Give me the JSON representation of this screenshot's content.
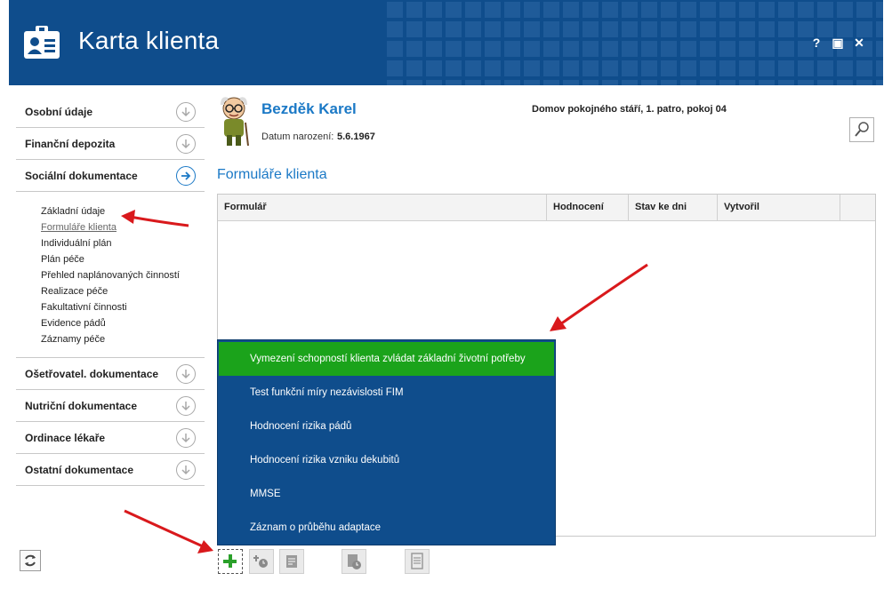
{
  "app": {
    "title": "Karta klienta",
    "help_label": "?",
    "maximize_label": "▣",
    "close_label": "✕"
  },
  "sidebar": {
    "sections": [
      {
        "label": "Osobní údaje"
      },
      {
        "label": "Finanční depozita"
      },
      {
        "label": "Sociální dokumentace",
        "active": true
      },
      {
        "label": "Ošetřovatel. dokumentace"
      },
      {
        "label": "Nutriční dokumentace"
      },
      {
        "label": "Ordinace lékaře"
      },
      {
        "label": "Ostatní dokumentace"
      }
    ],
    "subitems": [
      {
        "label": "Základní údaje"
      },
      {
        "label": "Formuláře klienta",
        "current": true
      },
      {
        "label": "Individuální plán"
      },
      {
        "label": "Plán péče"
      },
      {
        "label": "Přehled naplánovaných činností"
      },
      {
        "label": "Realizace péče"
      },
      {
        "label": "Fakultativní činnosti"
      },
      {
        "label": "Evidence pádů"
      },
      {
        "label": "Záznamy péče"
      }
    ]
  },
  "client": {
    "name": "Bezděk Karel",
    "dob_label": "Datum narození:",
    "dob_value": "5.6.1967",
    "location": "Domov pokojného stáří, 1. patro, pokoj 04"
  },
  "main": {
    "section_title": "Formuláře klienta",
    "table": {
      "columns": [
        "Formulář",
        "Hodnocení",
        "Stav ke dni",
        "Vytvořil"
      ],
      "rows": []
    }
  },
  "menu": {
    "items": [
      {
        "label": "Vymezení schopností klienta zvládat základní životní potřeby",
        "highlighted": true
      },
      {
        "label": "Test funkční míry nezávislosti FIM"
      },
      {
        "label": "Hodnocení rizika pádů"
      },
      {
        "label": "Hodnocení rizika vzniku dekubitů"
      },
      {
        "label": "MMSE"
      },
      {
        "label": "Záznam o průběhu adaptace"
      }
    ]
  },
  "toolbar": {
    "buttons": [
      {
        "icon": "plus-icon",
        "state": "active"
      },
      {
        "icon": "add-scheduled-icon",
        "state": "disabled"
      },
      {
        "icon": "edit-form-icon",
        "state": "disabled"
      },
      {
        "icon": "form-history-icon",
        "state": "disabled"
      },
      {
        "icon": "document-icon",
        "state": "disabled"
      }
    ]
  },
  "colors": {
    "header_bg": "#0f4d8c",
    "accent_blue": "#1b79c6",
    "menu_bg": "#0f4d8c",
    "menu_highlight": "#1ba31b",
    "annotation_red": "#d9191c"
  }
}
